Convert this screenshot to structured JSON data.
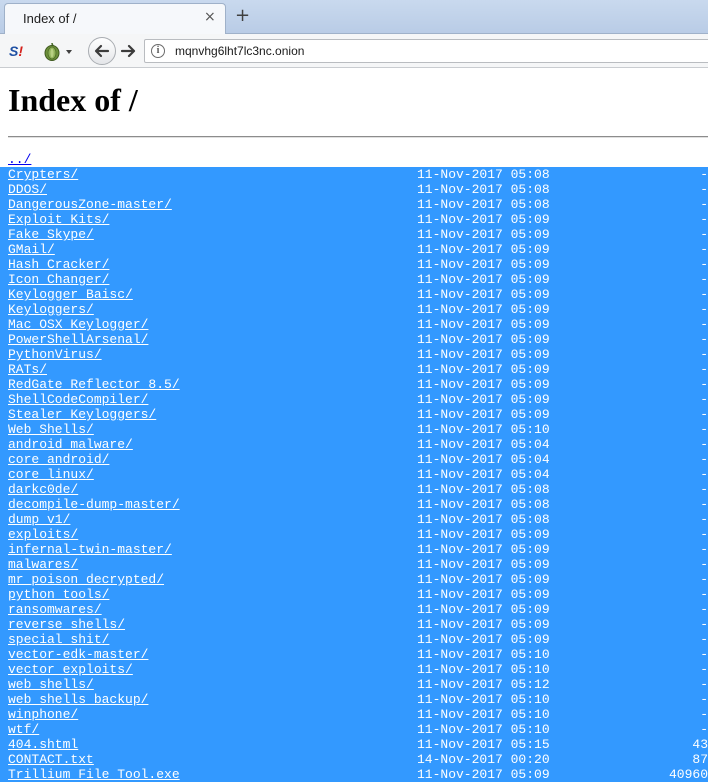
{
  "browser": {
    "tab_title": "Index of /",
    "tab_close": "×",
    "new_tab": "+",
    "url": "mqnvhg6lht7lc3nc.onion",
    "noscript_label_s": "S",
    "noscript_label_i": "!",
    "info_glyph": "i"
  },
  "page": {
    "title": "Index of /",
    "parent_link": "../",
    "entries": [
      {
        "name": "Crypters/",
        "date": "11-Nov-2017 05:08",
        "size": "-"
      },
      {
        "name": "DDOS/",
        "date": "11-Nov-2017 05:08",
        "size": "-"
      },
      {
        "name": "DangerousZone-master/",
        "date": "11-Nov-2017 05:08",
        "size": "-"
      },
      {
        "name": "Exploit Kits/",
        "date": "11-Nov-2017 05:09",
        "size": "-"
      },
      {
        "name": "Fake_Skype/",
        "date": "11-Nov-2017 05:09",
        "size": "-"
      },
      {
        "name": "GMail/",
        "date": "11-Nov-2017 05:09",
        "size": "-"
      },
      {
        "name": "Hash Cracker/",
        "date": "11-Nov-2017 05:09",
        "size": "-"
      },
      {
        "name": "Icon Changer/",
        "date": "11-Nov-2017 05:09",
        "size": "-"
      },
      {
        "name": "Keylogger Baisc/",
        "date": "11-Nov-2017 05:09",
        "size": "-"
      },
      {
        "name": "Keyloggers/",
        "date": "11-Nov-2017 05:09",
        "size": "-"
      },
      {
        "name": "Mac_OSX_Keylogger/",
        "date": "11-Nov-2017 05:09",
        "size": "-"
      },
      {
        "name": "PowerShellArsenal/",
        "date": "11-Nov-2017 05:09",
        "size": "-"
      },
      {
        "name": "PythonVirus/",
        "date": "11-Nov-2017 05:09",
        "size": "-"
      },
      {
        "name": "RATs/",
        "date": "11-Nov-2017 05:09",
        "size": "-"
      },
      {
        "name": "RedGate Reflector 8.5/",
        "date": "11-Nov-2017 05:09",
        "size": "-"
      },
      {
        "name": "ShellCodeCompiler/",
        "date": "11-Nov-2017 05:09",
        "size": "-"
      },
      {
        "name": "Stealer_Keyloggers/",
        "date": "11-Nov-2017 05:09",
        "size": "-"
      },
      {
        "name": "Web Shells/",
        "date": "11-Nov-2017 05:10",
        "size": "-"
      },
      {
        "name": "android_malware/",
        "date": "11-Nov-2017 05:04",
        "size": "-"
      },
      {
        "name": "core_android/",
        "date": "11-Nov-2017 05:04",
        "size": "-"
      },
      {
        "name": "core_linux/",
        "date": "11-Nov-2017 05:04",
        "size": "-"
      },
      {
        "name": "darkc0de/",
        "date": "11-Nov-2017 05:08",
        "size": "-"
      },
      {
        "name": "decompile-dump-master/",
        "date": "11-Nov-2017 05:08",
        "size": "-"
      },
      {
        "name": "dump_v1/",
        "date": "11-Nov-2017 05:08",
        "size": "-"
      },
      {
        "name": "exploits/",
        "date": "11-Nov-2017 05:09",
        "size": "-"
      },
      {
        "name": "infernal-twin-master/",
        "date": "11-Nov-2017 05:09",
        "size": "-"
      },
      {
        "name": "malwares/",
        "date": "11-Nov-2017 05:09",
        "size": "-"
      },
      {
        "name": "mr_poison_decrypted/",
        "date": "11-Nov-2017 05:09",
        "size": "-"
      },
      {
        "name": "python_tools/",
        "date": "11-Nov-2017 05:09",
        "size": "-"
      },
      {
        "name": "ransomwares/",
        "date": "11-Nov-2017 05:09",
        "size": "-"
      },
      {
        "name": "reverse_shells/",
        "date": "11-Nov-2017 05:09",
        "size": "-"
      },
      {
        "name": "special_shit/",
        "date": "11-Nov-2017 05:09",
        "size": "-"
      },
      {
        "name": "vector-edk-master/",
        "date": "11-Nov-2017 05:10",
        "size": "-"
      },
      {
        "name": "vector_exploits/",
        "date": "11-Nov-2017 05:10",
        "size": "-"
      },
      {
        "name": "web_shells/",
        "date": "11-Nov-2017 05:12",
        "size": "-"
      },
      {
        "name": "web_shells_backup/",
        "date": "11-Nov-2017 05:10",
        "size": "-"
      },
      {
        "name": "winphone/",
        "date": "11-Nov-2017 05:10",
        "size": "-"
      },
      {
        "name": "wtf/",
        "date": "11-Nov-2017 05:10",
        "size": "-"
      },
      {
        "name": "404.shtml",
        "date": "11-Nov-2017 05:15",
        "size": "43"
      },
      {
        "name": "CONTACT.txt",
        "date": "14-Nov-2017 00:20",
        "size": "87"
      },
      {
        "name": "Trillium File Tool.exe",
        "date": "11-Nov-2017 05:09",
        "size": "40960"
      }
    ]
  },
  "colors": {
    "selection": "#3399ff",
    "link": "#0000ee"
  }
}
